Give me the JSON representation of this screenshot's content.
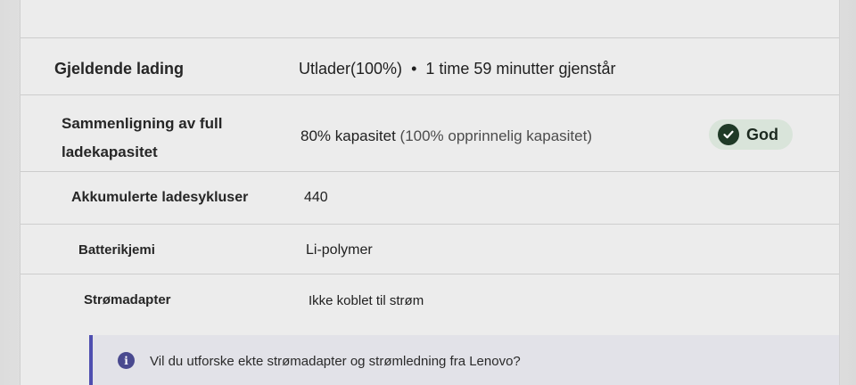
{
  "battery_details": {
    "rows": [
      {
        "label": "Gjeldende lading",
        "status": "Utlader(100%)",
        "separator": "•",
        "remaining": "1 time 59 minutter gjenstår"
      },
      {
        "label": "Sammenligning av full ladekapasitet",
        "value_main": "80% kapasitet",
        "value_note": "(100% opprinnelig kapasitet)",
        "badge": {
          "label": "God",
          "icon": "checkmark-circle-icon",
          "icon_color": "#1f3a27",
          "background": "#d9e4da"
        }
      },
      {
        "label": "Akkumulerte ladesykluser",
        "value": "440"
      },
      {
        "label": "Batterikjemi",
        "value": "Li-polymer"
      },
      {
        "label": "Strømadapter",
        "value": "Ikke koblet til strøm"
      }
    ]
  },
  "info_banner": {
    "icon": "info-icon",
    "text": "Vil du utforske ekte strømadapter og strømledning fra Lenovo?",
    "accent_color": "#4f4fb0"
  }
}
